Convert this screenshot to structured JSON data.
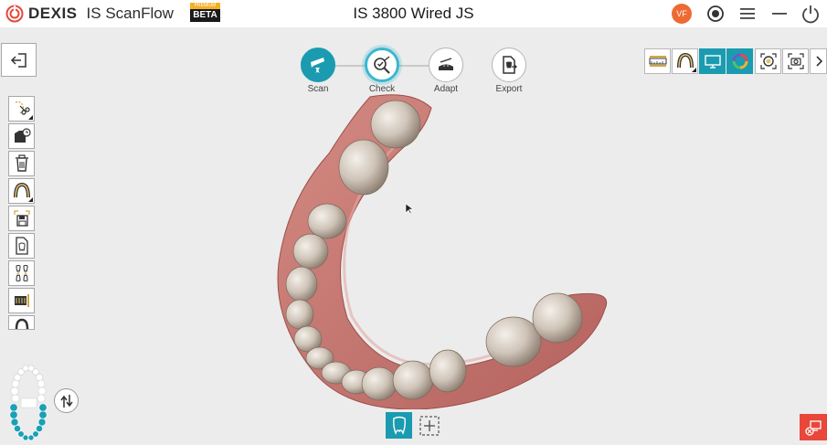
{
  "app": {
    "brand": "DEXIS",
    "name": "IS ScanFlow",
    "badge_top": "PREMIUM",
    "badge_bottom": "BETA",
    "window_title": "IS 3800  Wired JS",
    "user_initials": "VF"
  },
  "titlebar_icons": [
    "record-icon",
    "menu-icon",
    "minimize-icon",
    "power-icon"
  ],
  "workflow": {
    "steps": [
      {
        "label": "Scan",
        "icon": "scanner-icon",
        "state": "completed"
      },
      {
        "label": "Check",
        "icon": "check-magnifier-icon",
        "state": "current"
      },
      {
        "label": "Adapt",
        "icon": "adapt-icon",
        "state": "pending"
      },
      {
        "label": "Export",
        "icon": "export-icon",
        "state": "pending"
      }
    ]
  },
  "right_toolbar": [
    "ruler-icon",
    "jaw-icon",
    "monitor-icon",
    "color-wheel-icon",
    "zoom-fit-icon",
    "camera-icon",
    "chevron-right-icon"
  ],
  "left_toolbar": [
    "trim-icon",
    "open-history-icon",
    "trash-icon",
    "jaw-select-icon",
    "save-scan-icon",
    "tooth-file-icon",
    "bite-icon",
    "ruler-bar-icon",
    "arch-partial-icon"
  ],
  "bottom_toolbar": [
    "tooth-mode-icon",
    "add-icon"
  ],
  "colors": {
    "accent": "#1a9bb0",
    "avatar": "#ee6a33",
    "badge_premium": "#f5b025",
    "error": "#e8473a",
    "background": "#ececec"
  }
}
